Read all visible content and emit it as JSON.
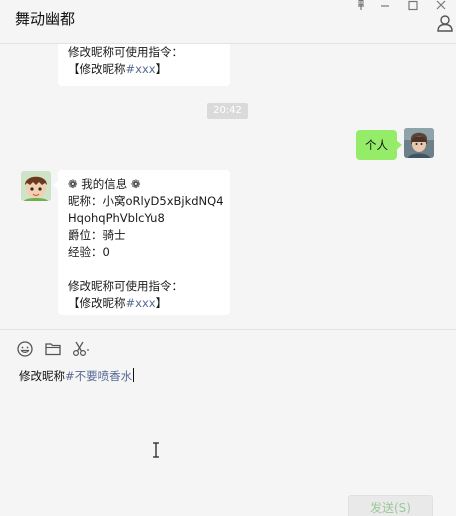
{
  "window": {
    "title": "舞动幽都"
  },
  "messages": {
    "bot_top": {
      "line1": "修改昵称可使用指令：",
      "line2_prefix": "【修改昵称",
      "line2_link": "#xxx",
      "line2_suffix": "】"
    },
    "time": "20:42",
    "me": {
      "text": "个人"
    },
    "bot_info": {
      "header": "我的信息",
      "nickname_line1": "昵称：小窝oRlyD5xBjkdNQ4",
      "nickname_line2": "HqohqPhVblcYu8",
      "rank": "爵位：骑士",
      "exp": "经验：0",
      "hint": "修改昵称可使用指令：",
      "cmd_prefix": "【修改昵称",
      "cmd_link": "#xxx",
      "cmd_suffix": "】"
    }
  },
  "composer": {
    "draft_prefix": "修改昵称",
    "draft_tag": "#不要喷香水",
    "send_label": "发送(S)"
  },
  "icons": {
    "pin": "pin-icon",
    "minimize": "minimize-icon",
    "maximize": "maximize-icon",
    "close": "close-icon",
    "contact": "user-icon",
    "emoji": "emoji-icon",
    "file": "folder-icon",
    "screenshot": "scissors-icon"
  },
  "colors": {
    "background": "#f5f5f5",
    "my_bubble": "#95ec69",
    "link": "#576b95",
    "time_badge": "#dadada"
  }
}
